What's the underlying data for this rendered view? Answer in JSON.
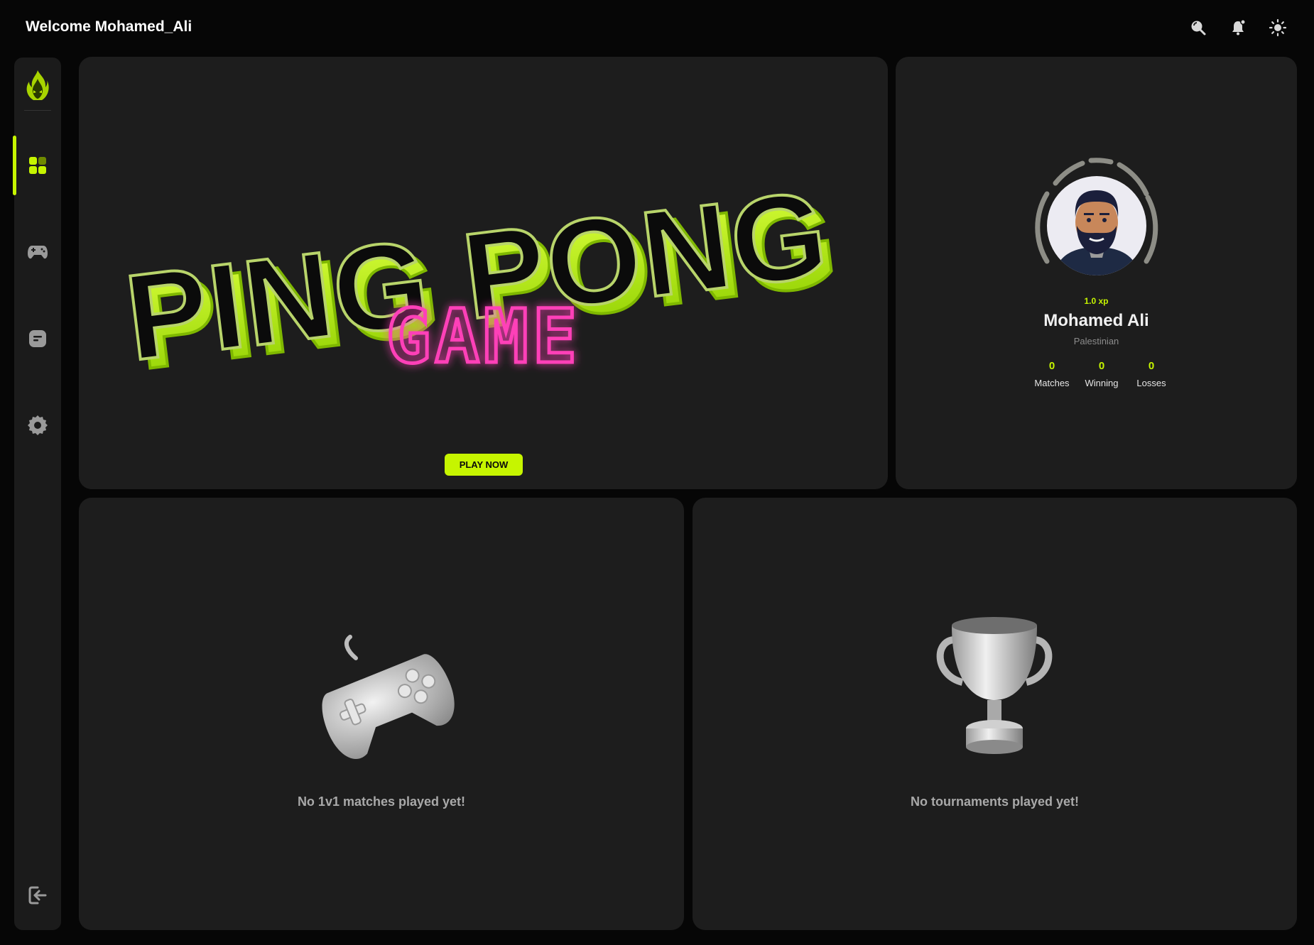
{
  "header": {
    "welcome": "Welcome Mohamed_Ali",
    "icons": [
      "search-icon",
      "notification-bell-icon",
      "theme-toggle-sun-icon"
    ]
  },
  "sidebar": {
    "logo": "flame-logo",
    "items": [
      {
        "name": "dashboard",
        "icon": "grid-icon",
        "active": true
      },
      {
        "name": "game",
        "icon": "gamepad-icon",
        "active": false
      },
      {
        "name": "chat",
        "icon": "chat-icon",
        "active": false
      },
      {
        "name": "settings",
        "icon": "gear-icon",
        "active": false
      }
    ],
    "logout_icon": "logout-icon"
  },
  "hero": {
    "title_line1": "PING PONG",
    "title_line2": "GAME",
    "play_button": "PLAY NOW"
  },
  "profile": {
    "xp": "1.0 xp",
    "name": "Mohamed Ali",
    "nationality": "Palestinian",
    "stats": [
      {
        "value": "0",
        "label": "Matches"
      },
      {
        "value": "0",
        "label": "Winning"
      },
      {
        "value": "0",
        "label": "Losses"
      }
    ]
  },
  "matches_panel": {
    "message": "No 1v1 matches played yet!"
  },
  "tournaments_panel": {
    "message": "No tournaments played yet!"
  },
  "colors": {
    "accent": "#c6f500",
    "background": "#060606",
    "card": "#1d1d1d",
    "neon_pink": "#ff3fb8"
  }
}
